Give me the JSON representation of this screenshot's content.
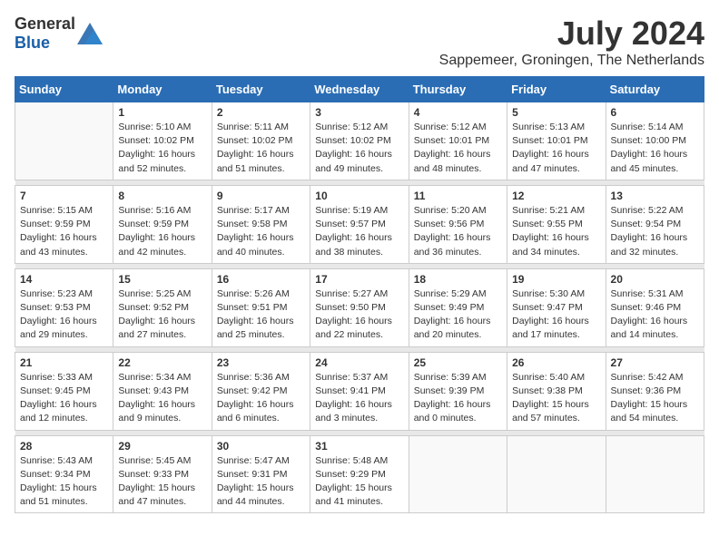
{
  "header": {
    "logo_general": "General",
    "logo_blue": "Blue",
    "month_title": "July 2024",
    "location": "Sappemeer, Groningen, The Netherlands"
  },
  "weekdays": [
    "Sunday",
    "Monday",
    "Tuesday",
    "Wednesday",
    "Thursday",
    "Friday",
    "Saturday"
  ],
  "weeks": [
    [
      {
        "day": "",
        "info": ""
      },
      {
        "day": "1",
        "info": "Sunrise: 5:10 AM\nSunset: 10:02 PM\nDaylight: 16 hours\nand 52 minutes."
      },
      {
        "day": "2",
        "info": "Sunrise: 5:11 AM\nSunset: 10:02 PM\nDaylight: 16 hours\nand 51 minutes."
      },
      {
        "day": "3",
        "info": "Sunrise: 5:12 AM\nSunset: 10:02 PM\nDaylight: 16 hours\nand 49 minutes."
      },
      {
        "day": "4",
        "info": "Sunrise: 5:12 AM\nSunset: 10:01 PM\nDaylight: 16 hours\nand 48 minutes."
      },
      {
        "day": "5",
        "info": "Sunrise: 5:13 AM\nSunset: 10:01 PM\nDaylight: 16 hours\nand 47 minutes."
      },
      {
        "day": "6",
        "info": "Sunrise: 5:14 AM\nSunset: 10:00 PM\nDaylight: 16 hours\nand 45 minutes."
      }
    ],
    [
      {
        "day": "7",
        "info": "Sunrise: 5:15 AM\nSunset: 9:59 PM\nDaylight: 16 hours\nand 43 minutes."
      },
      {
        "day": "8",
        "info": "Sunrise: 5:16 AM\nSunset: 9:59 PM\nDaylight: 16 hours\nand 42 minutes."
      },
      {
        "day": "9",
        "info": "Sunrise: 5:17 AM\nSunset: 9:58 PM\nDaylight: 16 hours\nand 40 minutes."
      },
      {
        "day": "10",
        "info": "Sunrise: 5:19 AM\nSunset: 9:57 PM\nDaylight: 16 hours\nand 38 minutes."
      },
      {
        "day": "11",
        "info": "Sunrise: 5:20 AM\nSunset: 9:56 PM\nDaylight: 16 hours\nand 36 minutes."
      },
      {
        "day": "12",
        "info": "Sunrise: 5:21 AM\nSunset: 9:55 PM\nDaylight: 16 hours\nand 34 minutes."
      },
      {
        "day": "13",
        "info": "Sunrise: 5:22 AM\nSunset: 9:54 PM\nDaylight: 16 hours\nand 32 minutes."
      }
    ],
    [
      {
        "day": "14",
        "info": "Sunrise: 5:23 AM\nSunset: 9:53 PM\nDaylight: 16 hours\nand 29 minutes."
      },
      {
        "day": "15",
        "info": "Sunrise: 5:25 AM\nSunset: 9:52 PM\nDaylight: 16 hours\nand 27 minutes."
      },
      {
        "day": "16",
        "info": "Sunrise: 5:26 AM\nSunset: 9:51 PM\nDaylight: 16 hours\nand 25 minutes."
      },
      {
        "day": "17",
        "info": "Sunrise: 5:27 AM\nSunset: 9:50 PM\nDaylight: 16 hours\nand 22 minutes."
      },
      {
        "day": "18",
        "info": "Sunrise: 5:29 AM\nSunset: 9:49 PM\nDaylight: 16 hours\nand 20 minutes."
      },
      {
        "day": "19",
        "info": "Sunrise: 5:30 AM\nSunset: 9:47 PM\nDaylight: 16 hours\nand 17 minutes."
      },
      {
        "day": "20",
        "info": "Sunrise: 5:31 AM\nSunset: 9:46 PM\nDaylight: 16 hours\nand 14 minutes."
      }
    ],
    [
      {
        "day": "21",
        "info": "Sunrise: 5:33 AM\nSunset: 9:45 PM\nDaylight: 16 hours\nand 12 minutes."
      },
      {
        "day": "22",
        "info": "Sunrise: 5:34 AM\nSunset: 9:43 PM\nDaylight: 16 hours\nand 9 minutes."
      },
      {
        "day": "23",
        "info": "Sunrise: 5:36 AM\nSunset: 9:42 PM\nDaylight: 16 hours\nand 6 minutes."
      },
      {
        "day": "24",
        "info": "Sunrise: 5:37 AM\nSunset: 9:41 PM\nDaylight: 16 hours\nand 3 minutes."
      },
      {
        "day": "25",
        "info": "Sunrise: 5:39 AM\nSunset: 9:39 PM\nDaylight: 16 hours\nand 0 minutes."
      },
      {
        "day": "26",
        "info": "Sunrise: 5:40 AM\nSunset: 9:38 PM\nDaylight: 15 hours\nand 57 minutes."
      },
      {
        "day": "27",
        "info": "Sunrise: 5:42 AM\nSunset: 9:36 PM\nDaylight: 15 hours\nand 54 minutes."
      }
    ],
    [
      {
        "day": "28",
        "info": "Sunrise: 5:43 AM\nSunset: 9:34 PM\nDaylight: 15 hours\nand 51 minutes."
      },
      {
        "day": "29",
        "info": "Sunrise: 5:45 AM\nSunset: 9:33 PM\nDaylight: 15 hours\nand 47 minutes."
      },
      {
        "day": "30",
        "info": "Sunrise: 5:47 AM\nSunset: 9:31 PM\nDaylight: 15 hours\nand 44 minutes."
      },
      {
        "day": "31",
        "info": "Sunrise: 5:48 AM\nSunset: 9:29 PM\nDaylight: 15 hours\nand 41 minutes."
      },
      {
        "day": "",
        "info": ""
      },
      {
        "day": "",
        "info": ""
      },
      {
        "day": "",
        "info": ""
      }
    ]
  ]
}
